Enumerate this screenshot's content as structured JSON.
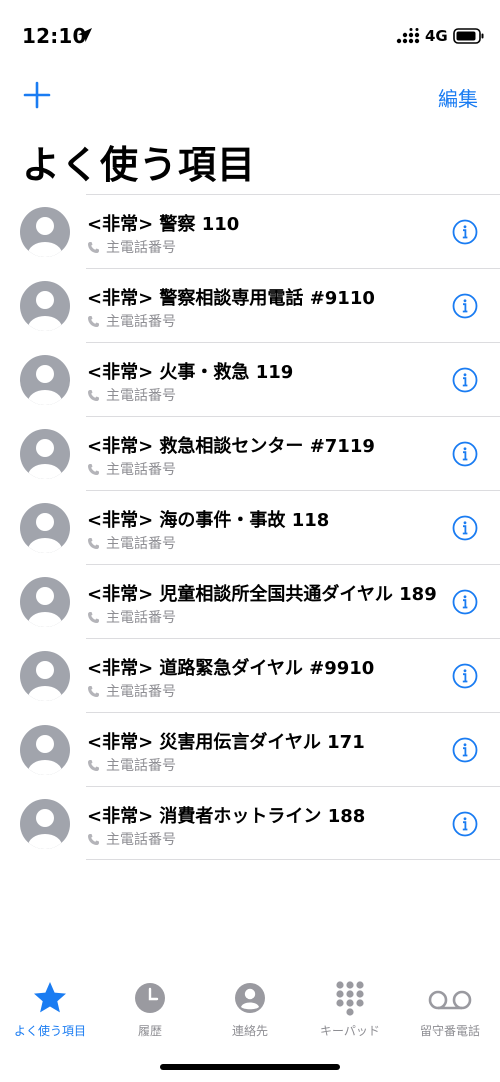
{
  "status": {
    "time": "12:10",
    "network": "4G"
  },
  "nav": {
    "edit_label": "編集"
  },
  "page": {
    "title": "よく使う項目"
  },
  "favorites": [
    {
      "name": "<非常> 警察 110",
      "label": "主電話番号"
    },
    {
      "name": "<非常> 警察相談専用電話 #9110",
      "label": "主電話番号"
    },
    {
      "name": "<非常> 火事・救急 119",
      "label": "主電話番号"
    },
    {
      "name": "<非常> 救急相談センター #7119",
      "label": "主電話番号"
    },
    {
      "name": "<非常> 海の事件・事故 118",
      "label": "主電話番号"
    },
    {
      "name": "<非常> 児童相談所全国共通ダイヤル 189",
      "label": "主電話番号"
    },
    {
      "name": "<非常> 道路緊急ダイヤル #9910",
      "label": "主電話番号"
    },
    {
      "name": "<非常> 災害用伝言ダイヤル 171",
      "label": "主電話番号"
    },
    {
      "name": "<非常> 消費者ホットライン 188",
      "label": "主電話番号"
    }
  ],
  "tabs": [
    {
      "label": "よく使う項目",
      "icon": "star-icon",
      "active": true
    },
    {
      "label": "履歴",
      "icon": "clock-icon",
      "active": false
    },
    {
      "label": "連絡先",
      "icon": "contact-icon",
      "active": false
    },
    {
      "label": "キーパッド",
      "icon": "keypad-icon",
      "active": false
    },
    {
      "label": "留守番電話",
      "icon": "voicemail-icon",
      "active": false
    }
  ],
  "colors": {
    "accent": "#1a7cf2",
    "avatar": "#a1a4ac",
    "secondary_text": "#8e8e93"
  }
}
